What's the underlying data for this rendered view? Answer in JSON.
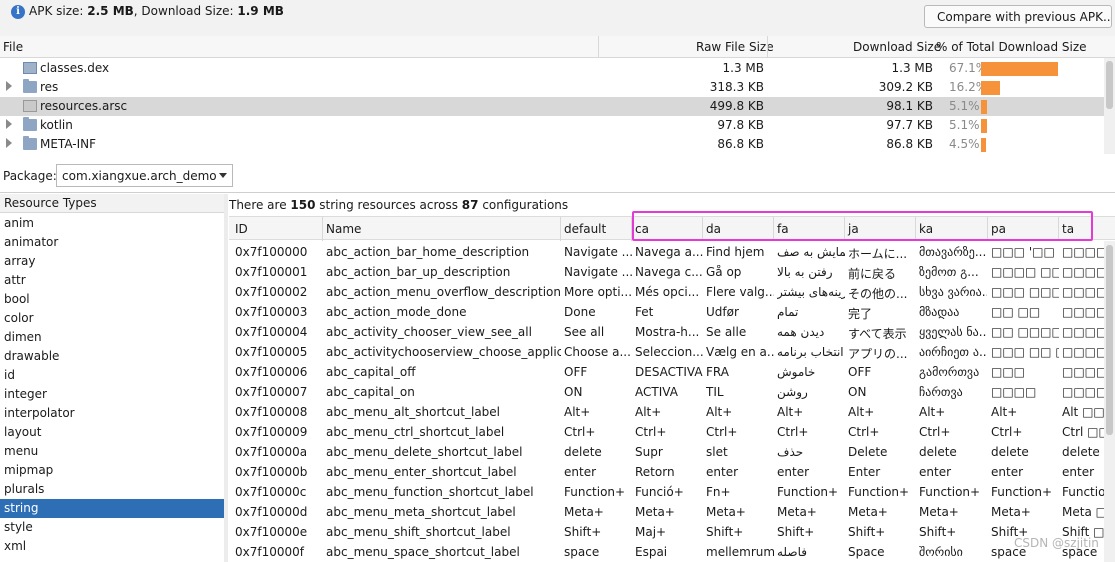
{
  "top": {
    "info_icon_glyph": "i",
    "apk_size_label": "APK size: ",
    "apk_size_value": "2.5 MB",
    "download_size_label": ", Download Size: ",
    "download_size_value": "1.9 MB",
    "compare_button": "Compare with previous APK..."
  },
  "files": {
    "headers": {
      "file": "File",
      "raw": "Raw File Size",
      "download": "Download Size",
      "percent": "% of Total Download Size"
    },
    "rows": [
      {
        "name": "classes.dex",
        "icon": "dex-file-icon",
        "expandable": false,
        "raw": "1.3 MB",
        "download": "1.3 MB",
        "percent": "67.1%",
        "fraction": 0.671,
        "selected": false
      },
      {
        "name": "res",
        "icon": "folder-icon",
        "expandable": true,
        "raw": "318.3 KB",
        "download": "309.2 KB",
        "percent": "16.2%",
        "fraction": 0.162,
        "selected": false
      },
      {
        "name": "resources.arsc",
        "icon": "arsc-file-icon",
        "expandable": false,
        "raw": "499.8 KB",
        "download": "98.1 KB",
        "percent": "5.1%",
        "fraction": 0.051,
        "selected": true
      },
      {
        "name": "kotlin",
        "icon": "folder-icon",
        "expandable": true,
        "raw": "97.8 KB",
        "download": "97.7 KB",
        "percent": "5.1%",
        "fraction": 0.051,
        "selected": false
      },
      {
        "name": "META-INF",
        "icon": "folder-icon",
        "expandable": true,
        "raw": "86.8 KB",
        "download": "86.8 KB",
        "percent": "4.5%",
        "fraction": 0.045,
        "selected": false
      }
    ],
    "bar_color": "#f5923a"
  },
  "package": {
    "label": "Package:",
    "value": "com.xiangxue.arch_demo"
  },
  "resource_types": {
    "header": "Resource Types",
    "items": [
      "anim",
      "animator",
      "array",
      "attr",
      "bool",
      "color",
      "dimen",
      "drawable",
      "id",
      "integer",
      "interpolator",
      "layout",
      "menu",
      "mipmap",
      "plurals",
      "string",
      "style",
      "xml"
    ],
    "selected": "string",
    "selected_color": "#2e6eb5"
  },
  "summary": {
    "prefix": "There are ",
    "count": "150",
    "middle": " string resources across ",
    "configs": "87",
    "suffix": " configurations"
  },
  "table": {
    "columns": [
      "ID",
      "Name",
      "default",
      "ca",
      "da",
      "fa",
      "ja",
      "ka",
      "pa",
      "ta"
    ],
    "rows": [
      [
        "0x7f100000",
        "abc_action_bar_home_description",
        "Navigate ...",
        "Navega a...",
        "Find hjem",
        "پیمایش به صف...",
        "ホームに...",
        "მთავარზე...",
        "□□□ '□□ □□□",
        "□□□□□□"
      ],
      [
        "0x7f100001",
        "abc_action_bar_up_description",
        "Navigate ...",
        "Navega c...",
        "Gå op",
        "رفتن به بالا",
        "前に戻る",
        "ზემოთ გ...",
        "□□□□ □□□",
        "□□□□□□"
      ],
      [
        "0x7f100002",
        "abc_action_menu_overflow_description",
        "More opti...",
        "Més opci...",
        "Flere valg...",
        "گزینه‌های بیشتر",
        "その他の...",
        "სხვა ვარია...",
        "□□□ □□□□",
        "□□□□□□"
      ],
      [
        "0x7f100003",
        "abc_action_mode_done",
        "Done",
        "Fet",
        "Udfør",
        "تمام",
        "完了",
        "მზადაა",
        "□□ □□",
        "□□□□□□"
      ],
      [
        "0x7f100004",
        "abc_activity_chooser_view_see_all",
        "See all",
        "Mostra-h...",
        "Se alle",
        "دیدن همه",
        "すべて表示",
        "ყველას ნა...",
        "□□ □□□□",
        "□□□□□□"
      ],
      [
        "0x7f100005",
        "abc_activitychooserview_choose_applica...",
        "Choose a...",
        "Seleccion...",
        "Vælg en a...",
        "انتخاب برنامه",
        "アプリの...",
        "აირჩიეთ ა...",
        "□□□ □□ □□□",
        "□□□□□□."
      ],
      [
        "0x7f100006",
        "abc_capital_off",
        "OFF",
        "DESACTIVA",
        "FRA",
        "خاموش",
        "OFF",
        "გამორთვა",
        "□□□",
        "□□□□□□"
      ],
      [
        "0x7f100007",
        "abc_capital_on",
        "ON",
        "ACTIVA",
        "TIL",
        "روشن",
        "ON",
        "ჩართვა",
        "□□□□",
        "□□□□"
      ],
      [
        "0x7f100008",
        "abc_menu_alt_shortcut_label",
        "Alt+",
        "Alt+",
        "Alt+",
        "Alt+",
        "Alt+",
        "Alt+",
        "Alt+",
        "Alt □□"
      ],
      [
        "0x7f100009",
        "abc_menu_ctrl_shortcut_label",
        "Ctrl+",
        "Ctrl+",
        "Ctrl+",
        "Ctrl+",
        "Ctrl+",
        "Ctrl+",
        "Ctrl+",
        "Ctrl □□"
      ],
      [
        "0x7f10000a",
        "abc_menu_delete_shortcut_label",
        "delete",
        "Supr",
        "slet",
        "حذف",
        "Delete",
        "delete",
        "delete",
        "delete"
      ],
      [
        "0x7f10000b",
        "abc_menu_enter_shortcut_label",
        "enter",
        "Retorn",
        "enter",
        "enter",
        "Enter",
        "enter",
        "enter",
        "enter"
      ],
      [
        "0x7f10000c",
        "abc_menu_function_shortcut_label",
        "Function+",
        "Funció+",
        "Fn+",
        "Function+",
        "Function+",
        "Function+",
        "Function+",
        "Functio"
      ],
      [
        "0x7f10000d",
        "abc_menu_meta_shortcut_label",
        "Meta+",
        "Meta+",
        "Meta+",
        "Meta+",
        "Meta+",
        "Meta+",
        "Meta+",
        "Meta □□"
      ],
      [
        "0x7f10000e",
        "abc_menu_shift_shortcut_label",
        "Shift+",
        "Maj+",
        "Shift+",
        "Shift+",
        "Shift+",
        "Shift+",
        "Shift+",
        "Shift □□"
      ],
      [
        "0x7f10000f",
        "abc_menu_space_shortcut_label",
        "space",
        "Espai",
        "mellemrum",
        "فاصله",
        "Space",
        "შორისი",
        "space",
        "space"
      ]
    ]
  },
  "watermark": "CSDN @szjitin",
  "highlight_color": "#e43ad8"
}
